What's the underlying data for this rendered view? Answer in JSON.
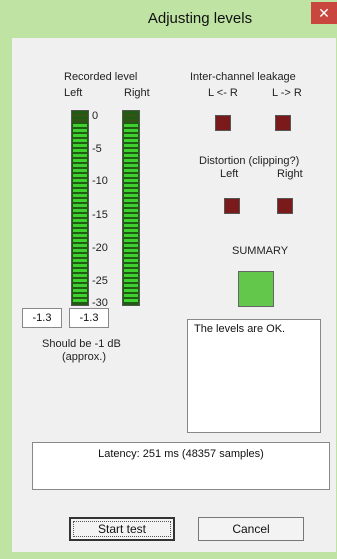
{
  "window": {
    "title": "Adjusting levels",
    "close_glyph": "✕"
  },
  "recorded": {
    "heading": "Recorded level",
    "left_label": "Left",
    "right_label": "Right",
    "ticks": [
      "0",
      "-5",
      "-10",
      "-15",
      "-20",
      "-25",
      "-30"
    ],
    "left_value": "-1.3",
    "right_value": "-1.3",
    "target_line1": "Should be  -1 dB",
    "target_line2": "(approx.)",
    "left_level_fraction": 0.96,
    "right_level_fraction": 0.96
  },
  "leakage": {
    "heading": "Inter-channel leakage",
    "l_to_r_label": "L <- R",
    "r_to_l_label": "L -> R"
  },
  "distortion": {
    "heading": "Distortion  (clipping?)",
    "left_label": "Left",
    "right_label": "Right"
  },
  "summary": {
    "label": "SUMMARY",
    "message": "The levels are OK."
  },
  "latency": {
    "text": "Latency: 251 ms (48357 samples)"
  },
  "buttons": {
    "start": "Start test",
    "cancel": "Cancel"
  },
  "colors": {
    "meter_on": "#3fd02f",
    "meter_top": "#a73030",
    "led_off": "#7a1a1a",
    "summary_ok": "#62c74b",
    "title_bar": "#bfe3a2"
  }
}
